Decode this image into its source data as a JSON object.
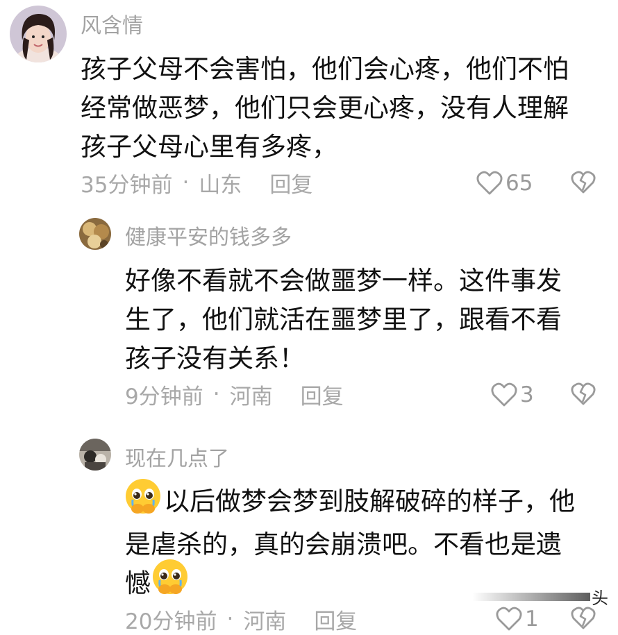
{
  "comments": [
    {
      "author": "风含情",
      "lines": [
        "孩子父母不会害怕，他们会心疼，他们不怕",
        "经常做恶梦，他们只会更心疼，没有人理解",
        "孩子父母心里有多疼，"
      ],
      "time": "35分钟前",
      "separator": "·",
      "location": "山东",
      "reply": "回复",
      "likes": "65"
    },
    {
      "author": "健康平安的钱多多",
      "lines": [
        "好像不看就不会做噩梦一样。这件事发",
        "生了，他们就活在噩梦里了，跟看不看",
        "孩子没有关系！"
      ],
      "time": "9分钟前",
      "separator": "·",
      "location": "河南",
      "reply": "回复",
      "likes": "3"
    },
    {
      "author": "现在几点了",
      "lines": [
        "以后做梦会梦到肢解破碎的样子，他",
        "是虐杀的，真的会崩溃吧。不看也是遗",
        "憾"
      ],
      "time": "20分钟前",
      "separator": "·",
      "location": "河南",
      "reply": "回复",
      "likes": "1"
    }
  ],
  "icons": {
    "like": "heart-outline-icon",
    "dislike": "broken-heart-icon",
    "emoji": "pleading-face-with-hands-emoji"
  },
  "watermark": "头"
}
